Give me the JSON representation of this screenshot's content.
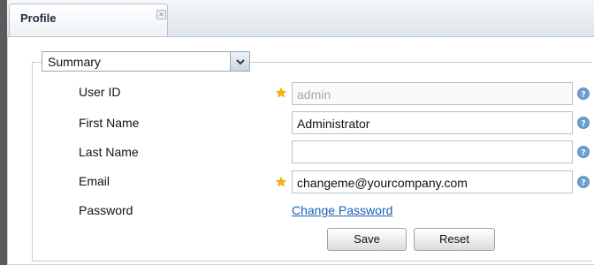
{
  "tab": {
    "title": "Profile",
    "close_glyph": "✕"
  },
  "section_select": {
    "value": "Summary"
  },
  "fields": {
    "user_id": {
      "label": "User ID",
      "value": "admin",
      "required": true
    },
    "first_name": {
      "label": "First Name",
      "value": "Administrator",
      "required": false
    },
    "last_name": {
      "label": "Last Name",
      "value": "",
      "required": false
    },
    "email": {
      "label": "Email",
      "value": "changeme@yourcompany.com",
      "required": true
    },
    "password": {
      "label": "Password",
      "link": "Change Password"
    }
  },
  "buttons": {
    "save": "Save",
    "reset": "Reset"
  },
  "icons": {
    "required": "star-icon",
    "help": "help-icon",
    "dropdown": "chevron-down-icon"
  },
  "colors": {
    "link": "#1a5fb4",
    "star": "#f2b705",
    "help": "#6f9fd0"
  }
}
